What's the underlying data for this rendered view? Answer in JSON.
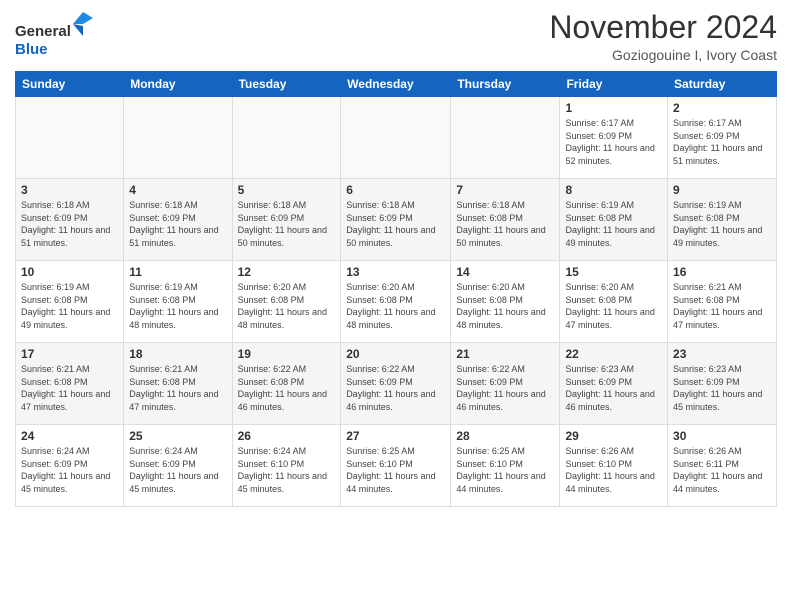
{
  "header": {
    "logo_line1": "General",
    "logo_line2": "Blue",
    "month_title": "November 2024",
    "location": "Goziogouine I, Ivory Coast"
  },
  "days_of_week": [
    "Sunday",
    "Monday",
    "Tuesday",
    "Wednesday",
    "Thursday",
    "Friday",
    "Saturday"
  ],
  "weeks": [
    [
      {
        "day": "",
        "info": ""
      },
      {
        "day": "",
        "info": ""
      },
      {
        "day": "",
        "info": ""
      },
      {
        "day": "",
        "info": ""
      },
      {
        "day": "",
        "info": ""
      },
      {
        "day": "1",
        "info": "Sunrise: 6:17 AM\nSunset: 6:09 PM\nDaylight: 11 hours and 52 minutes."
      },
      {
        "day": "2",
        "info": "Sunrise: 6:17 AM\nSunset: 6:09 PM\nDaylight: 11 hours and 51 minutes."
      }
    ],
    [
      {
        "day": "3",
        "info": "Sunrise: 6:18 AM\nSunset: 6:09 PM\nDaylight: 11 hours and 51 minutes."
      },
      {
        "day": "4",
        "info": "Sunrise: 6:18 AM\nSunset: 6:09 PM\nDaylight: 11 hours and 51 minutes."
      },
      {
        "day": "5",
        "info": "Sunrise: 6:18 AM\nSunset: 6:09 PM\nDaylight: 11 hours and 50 minutes."
      },
      {
        "day": "6",
        "info": "Sunrise: 6:18 AM\nSunset: 6:09 PM\nDaylight: 11 hours and 50 minutes."
      },
      {
        "day": "7",
        "info": "Sunrise: 6:18 AM\nSunset: 6:08 PM\nDaylight: 11 hours and 50 minutes."
      },
      {
        "day": "8",
        "info": "Sunrise: 6:19 AM\nSunset: 6:08 PM\nDaylight: 11 hours and 49 minutes."
      },
      {
        "day": "9",
        "info": "Sunrise: 6:19 AM\nSunset: 6:08 PM\nDaylight: 11 hours and 49 minutes."
      }
    ],
    [
      {
        "day": "10",
        "info": "Sunrise: 6:19 AM\nSunset: 6:08 PM\nDaylight: 11 hours and 49 minutes."
      },
      {
        "day": "11",
        "info": "Sunrise: 6:19 AM\nSunset: 6:08 PM\nDaylight: 11 hours and 48 minutes."
      },
      {
        "day": "12",
        "info": "Sunrise: 6:20 AM\nSunset: 6:08 PM\nDaylight: 11 hours and 48 minutes."
      },
      {
        "day": "13",
        "info": "Sunrise: 6:20 AM\nSunset: 6:08 PM\nDaylight: 11 hours and 48 minutes."
      },
      {
        "day": "14",
        "info": "Sunrise: 6:20 AM\nSunset: 6:08 PM\nDaylight: 11 hours and 48 minutes."
      },
      {
        "day": "15",
        "info": "Sunrise: 6:20 AM\nSunset: 6:08 PM\nDaylight: 11 hours and 47 minutes."
      },
      {
        "day": "16",
        "info": "Sunrise: 6:21 AM\nSunset: 6:08 PM\nDaylight: 11 hours and 47 minutes."
      }
    ],
    [
      {
        "day": "17",
        "info": "Sunrise: 6:21 AM\nSunset: 6:08 PM\nDaylight: 11 hours and 47 minutes."
      },
      {
        "day": "18",
        "info": "Sunrise: 6:21 AM\nSunset: 6:08 PM\nDaylight: 11 hours and 47 minutes."
      },
      {
        "day": "19",
        "info": "Sunrise: 6:22 AM\nSunset: 6:08 PM\nDaylight: 11 hours and 46 minutes."
      },
      {
        "day": "20",
        "info": "Sunrise: 6:22 AM\nSunset: 6:09 PM\nDaylight: 11 hours and 46 minutes."
      },
      {
        "day": "21",
        "info": "Sunrise: 6:22 AM\nSunset: 6:09 PM\nDaylight: 11 hours and 46 minutes."
      },
      {
        "day": "22",
        "info": "Sunrise: 6:23 AM\nSunset: 6:09 PM\nDaylight: 11 hours and 46 minutes."
      },
      {
        "day": "23",
        "info": "Sunrise: 6:23 AM\nSunset: 6:09 PM\nDaylight: 11 hours and 45 minutes."
      }
    ],
    [
      {
        "day": "24",
        "info": "Sunrise: 6:24 AM\nSunset: 6:09 PM\nDaylight: 11 hours and 45 minutes."
      },
      {
        "day": "25",
        "info": "Sunrise: 6:24 AM\nSunset: 6:09 PM\nDaylight: 11 hours and 45 minutes."
      },
      {
        "day": "26",
        "info": "Sunrise: 6:24 AM\nSunset: 6:10 PM\nDaylight: 11 hours and 45 minutes."
      },
      {
        "day": "27",
        "info": "Sunrise: 6:25 AM\nSunset: 6:10 PM\nDaylight: 11 hours and 44 minutes."
      },
      {
        "day": "28",
        "info": "Sunrise: 6:25 AM\nSunset: 6:10 PM\nDaylight: 11 hours and 44 minutes."
      },
      {
        "day": "29",
        "info": "Sunrise: 6:26 AM\nSunset: 6:10 PM\nDaylight: 11 hours and 44 minutes."
      },
      {
        "day": "30",
        "info": "Sunrise: 6:26 AM\nSunset: 6:11 PM\nDaylight: 11 hours and 44 minutes."
      }
    ]
  ]
}
